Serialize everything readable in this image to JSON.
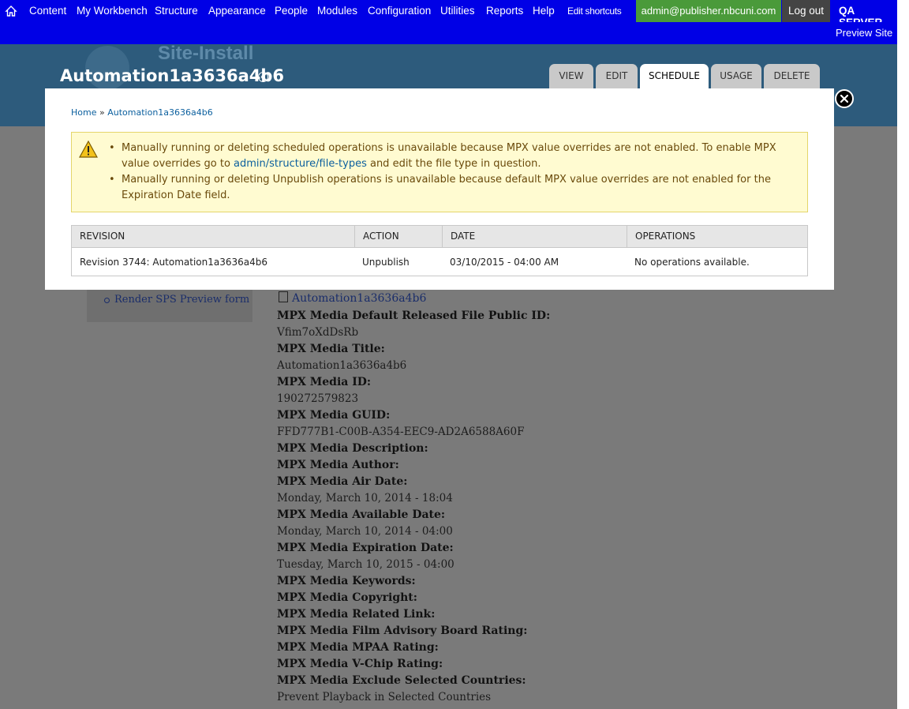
{
  "toolbar": {
    "items": [
      "Content",
      "My Workbench",
      "Structure",
      "Appearance",
      "People",
      "Modules",
      "Configuration",
      "Utilities",
      "Reports",
      "Help"
    ],
    "edit_shortcuts": "Edit shortcuts",
    "user": "admin@publisher.nbcuni.com",
    "logout": "Log out",
    "server": "QA SERVER",
    "preview_site": "Preview Site"
  },
  "header": {
    "site_name": "Site-Install",
    "page_title": "Automation1a3636a4b6",
    "tabs": [
      "VIEW",
      "EDIT",
      "SCHEDULE",
      "USAGE",
      "DELETE"
    ],
    "active_tab": "SCHEDULE"
  },
  "dialog": {
    "breadcrumb": {
      "home": "Home",
      "separator": " » ",
      "current": "Automation1a3636a4b6"
    },
    "warnings": [
      {
        "before": "Manually running or deleting scheduled operations is unavailable because MPX value overrides are not enabled. To enable MPX value overrides go to ",
        "link": "admin/structure/file-types",
        "after": " and edit the file type in question."
      },
      {
        "before": "Manually running or deleting Unpublish operations is unavailable because default MPX value overrides are not enabled for the Expiration Date field.",
        "link": "",
        "after": ""
      }
    ],
    "table": {
      "headers": [
        "REVISION",
        "ACTION",
        "DATE",
        "OPERATIONS"
      ],
      "rows": [
        [
          "Revision 3744: Automation1a3636a4b6",
          "Unpublish",
          "03/10/2015 - 04:00 AM",
          "No operations available."
        ]
      ]
    }
  },
  "background": {
    "sidebar_link": "Render SPS Preview form",
    "file_link": "Automation1a3636a4b6",
    "fields": [
      {
        "label": "MPX Media Default Released File Public ID:",
        "value": "Vfim7oXdDsRb"
      },
      {
        "label": "MPX Media Title:",
        "value": "Automation1a3636a4b6"
      },
      {
        "label": "MPX Media ID:",
        "value": "190272579823"
      },
      {
        "label": "MPX Media GUID:",
        "value": "FFD777B1-C00B-A354-EEC9-AD2A6588A60F"
      },
      {
        "label": "MPX Media Description:",
        "value": ""
      },
      {
        "label": "MPX Media Author:",
        "value": ""
      },
      {
        "label": "MPX Media Air Date:",
        "value": "Monday, March 10, 2014 - 18:04"
      },
      {
        "label": "MPX Media Available Date:",
        "value": "Monday, March 10, 2014 - 04:00"
      },
      {
        "label": "MPX Media Expiration Date:",
        "value": "Tuesday, March 10, 2015 - 04:00"
      },
      {
        "label": "MPX Media Keywords:",
        "value": ""
      },
      {
        "label": "MPX Media Copyright:",
        "value": ""
      },
      {
        "label": "MPX Media Related Link:",
        "value": ""
      },
      {
        "label": "MPX Media Film Advisory Board Rating:",
        "value": ""
      },
      {
        "label": "MPX Media MPAA Rating:",
        "value": ""
      },
      {
        "label": "MPX Media V-Chip Rating:",
        "value": ""
      },
      {
        "label": "MPX Media Exclude Selected Countries:",
        "value": "Prevent Playback in Selected Countries"
      }
    ]
  },
  "colors": {
    "toolbar": "#0000e6",
    "user_badge": "#4a9a3a",
    "header": "#2d5b7c",
    "warning_bg": "#fffbd1",
    "link": "#0b5f9e"
  }
}
